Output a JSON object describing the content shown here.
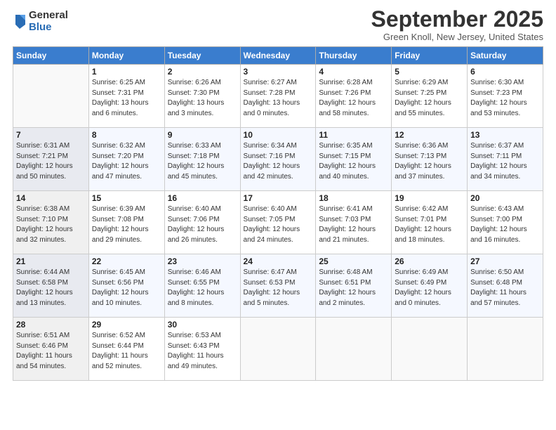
{
  "header": {
    "logo_general": "General",
    "logo_blue": "Blue",
    "title": "September 2025",
    "location": "Green Knoll, New Jersey, United States"
  },
  "columns": [
    "Sunday",
    "Monday",
    "Tuesday",
    "Wednesday",
    "Thursday",
    "Friday",
    "Saturday"
  ],
  "weeks": [
    [
      {
        "num": "",
        "info": ""
      },
      {
        "num": "1",
        "info": "Sunrise: 6:25 AM\nSunset: 7:31 PM\nDaylight: 13 hours\nand 6 minutes."
      },
      {
        "num": "2",
        "info": "Sunrise: 6:26 AM\nSunset: 7:30 PM\nDaylight: 13 hours\nand 3 minutes."
      },
      {
        "num": "3",
        "info": "Sunrise: 6:27 AM\nSunset: 7:28 PM\nDaylight: 13 hours\nand 0 minutes."
      },
      {
        "num": "4",
        "info": "Sunrise: 6:28 AM\nSunset: 7:26 PM\nDaylight: 12 hours\nand 58 minutes."
      },
      {
        "num": "5",
        "info": "Sunrise: 6:29 AM\nSunset: 7:25 PM\nDaylight: 12 hours\nand 55 minutes."
      },
      {
        "num": "6",
        "info": "Sunrise: 6:30 AM\nSunset: 7:23 PM\nDaylight: 12 hours\nand 53 minutes."
      }
    ],
    [
      {
        "num": "7",
        "info": "Sunrise: 6:31 AM\nSunset: 7:21 PM\nDaylight: 12 hours\nand 50 minutes."
      },
      {
        "num": "8",
        "info": "Sunrise: 6:32 AM\nSunset: 7:20 PM\nDaylight: 12 hours\nand 47 minutes."
      },
      {
        "num": "9",
        "info": "Sunrise: 6:33 AM\nSunset: 7:18 PM\nDaylight: 12 hours\nand 45 minutes."
      },
      {
        "num": "10",
        "info": "Sunrise: 6:34 AM\nSunset: 7:16 PM\nDaylight: 12 hours\nand 42 minutes."
      },
      {
        "num": "11",
        "info": "Sunrise: 6:35 AM\nSunset: 7:15 PM\nDaylight: 12 hours\nand 40 minutes."
      },
      {
        "num": "12",
        "info": "Sunrise: 6:36 AM\nSunset: 7:13 PM\nDaylight: 12 hours\nand 37 minutes."
      },
      {
        "num": "13",
        "info": "Sunrise: 6:37 AM\nSunset: 7:11 PM\nDaylight: 12 hours\nand 34 minutes."
      }
    ],
    [
      {
        "num": "14",
        "info": "Sunrise: 6:38 AM\nSunset: 7:10 PM\nDaylight: 12 hours\nand 32 minutes."
      },
      {
        "num": "15",
        "info": "Sunrise: 6:39 AM\nSunset: 7:08 PM\nDaylight: 12 hours\nand 29 minutes."
      },
      {
        "num": "16",
        "info": "Sunrise: 6:40 AM\nSunset: 7:06 PM\nDaylight: 12 hours\nand 26 minutes."
      },
      {
        "num": "17",
        "info": "Sunrise: 6:40 AM\nSunset: 7:05 PM\nDaylight: 12 hours\nand 24 minutes."
      },
      {
        "num": "18",
        "info": "Sunrise: 6:41 AM\nSunset: 7:03 PM\nDaylight: 12 hours\nand 21 minutes."
      },
      {
        "num": "19",
        "info": "Sunrise: 6:42 AM\nSunset: 7:01 PM\nDaylight: 12 hours\nand 18 minutes."
      },
      {
        "num": "20",
        "info": "Sunrise: 6:43 AM\nSunset: 7:00 PM\nDaylight: 12 hours\nand 16 minutes."
      }
    ],
    [
      {
        "num": "21",
        "info": "Sunrise: 6:44 AM\nSunset: 6:58 PM\nDaylight: 12 hours\nand 13 minutes."
      },
      {
        "num": "22",
        "info": "Sunrise: 6:45 AM\nSunset: 6:56 PM\nDaylight: 12 hours\nand 10 minutes."
      },
      {
        "num": "23",
        "info": "Sunrise: 6:46 AM\nSunset: 6:55 PM\nDaylight: 12 hours\nand 8 minutes."
      },
      {
        "num": "24",
        "info": "Sunrise: 6:47 AM\nSunset: 6:53 PM\nDaylight: 12 hours\nand 5 minutes."
      },
      {
        "num": "25",
        "info": "Sunrise: 6:48 AM\nSunset: 6:51 PM\nDaylight: 12 hours\nand 2 minutes."
      },
      {
        "num": "26",
        "info": "Sunrise: 6:49 AM\nSunset: 6:49 PM\nDaylight: 12 hours\nand 0 minutes."
      },
      {
        "num": "27",
        "info": "Sunrise: 6:50 AM\nSunset: 6:48 PM\nDaylight: 11 hours\nand 57 minutes."
      }
    ],
    [
      {
        "num": "28",
        "info": "Sunrise: 6:51 AM\nSunset: 6:46 PM\nDaylight: 11 hours\nand 54 minutes."
      },
      {
        "num": "29",
        "info": "Sunrise: 6:52 AM\nSunset: 6:44 PM\nDaylight: 11 hours\nand 52 minutes."
      },
      {
        "num": "30",
        "info": "Sunrise: 6:53 AM\nSunset: 6:43 PM\nDaylight: 11 hours\nand 49 minutes."
      },
      {
        "num": "",
        "info": ""
      },
      {
        "num": "",
        "info": ""
      },
      {
        "num": "",
        "info": ""
      },
      {
        "num": "",
        "info": ""
      }
    ]
  ]
}
